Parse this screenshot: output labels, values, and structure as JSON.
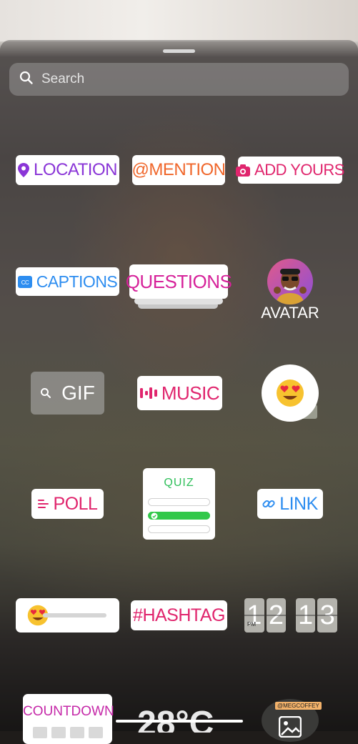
{
  "search": {
    "placeholder": "Search"
  },
  "stickers": {
    "location": "LOCATION",
    "mention": "@MENTION",
    "add_yours": "ADD YOURS",
    "captions": "CAPTIONS",
    "questions": "QUESTIONS",
    "avatar": "AVATAR",
    "gif": "GIF",
    "music": "MUSIC",
    "quiz": "QUIZ",
    "poll": "POLL",
    "link": "LINK",
    "hashtag": "#HASHTAG",
    "countdown": "COUNTDOWN",
    "clock": {
      "d1": "1",
      "d2": "2",
      "d3": "1",
      "d4": "3",
      "ampm": "PM"
    },
    "temperature": "28°C",
    "photo_tag": "@MEGCOFFEY"
  },
  "quiz": {
    "selected_index": 1
  },
  "colors": {
    "location": "#8a35d7",
    "mention": "#f0662a",
    "add_yours": "#e0256d",
    "captions": "#2d8df0",
    "questions": "#d6229a",
    "music": "#e0256d",
    "quiz": "#2fbf5a",
    "poll": "#e0256d",
    "link": "#2d8df0",
    "hashtag": "#e0256d",
    "countdown": "#c528a8"
  },
  "icons": [
    "search-icon",
    "location-pin-icon",
    "mention-icon",
    "camera-icon",
    "captions-icon",
    "avatar-icon",
    "gif-search-icon",
    "music-bars-icon",
    "heart-eyes-emoji-icon",
    "poll-lines-icon",
    "link-icon",
    "photo-icon"
  ]
}
